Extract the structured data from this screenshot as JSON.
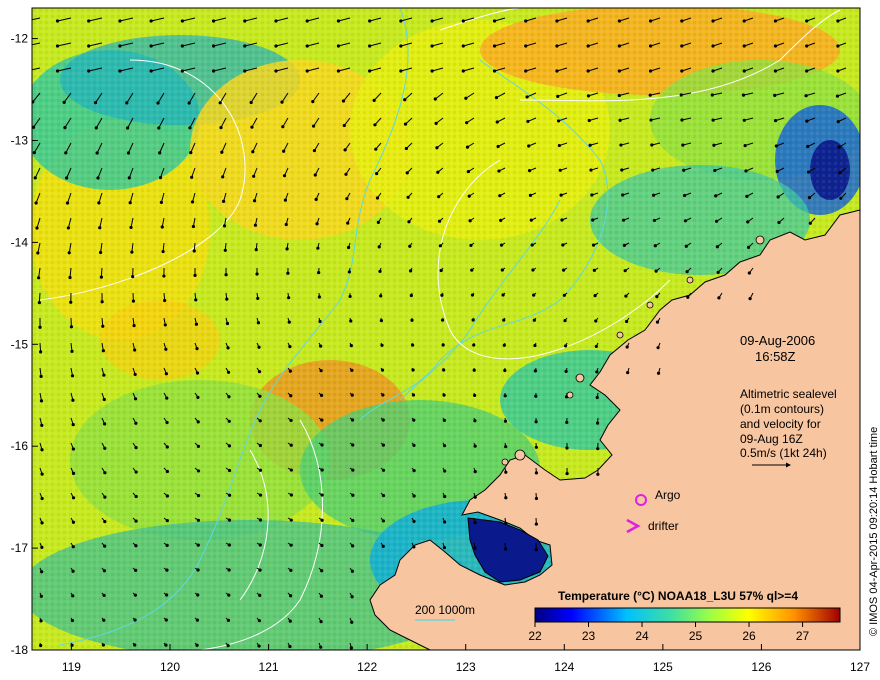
{
  "axes": {
    "lon_ticks": [
      "119",
      "120",
      "121",
      "122",
      "123",
      "124",
      "125",
      "126",
      "127"
    ],
    "lat_ticks": [
      "-12",
      "-13",
      "-14",
      "-15",
      "-16",
      "-17",
      "-18"
    ]
  },
  "map": {
    "lon_range": [
      118.6,
      127.0
    ],
    "lat_range": [
      -18.0,
      -11.7
    ],
    "land_color": "#f7c59f",
    "deep_water_color": "#0a1a8c",
    "contour_color": "#5fd8e0",
    "sealevel_contour_color": "#ffffff",
    "vector_color": "#000000"
  },
  "annotation": {
    "date": "09-Aug-2006",
    "time": "16:58Z",
    "desc_line1": "Altimetric sealevel",
    "desc_line2": "(0.1m contours)",
    "desc_line3": "and velocity for",
    "desc_line4": "09-Aug 16Z",
    "desc_line5": "0.5m/s (1kt 24h)"
  },
  "legend": {
    "argo": "Argo",
    "drifter": "drifter",
    "argo_color": "#e020e0",
    "depth_contours": "200  1000m"
  },
  "colorbar": {
    "title": "Temperature (°C) NOAA18_L3U 57% ql>=4",
    "ticks": [
      "22",
      "23",
      "24",
      "25",
      "26",
      "27"
    ],
    "range": [
      22,
      27.7
    ]
  },
  "credit": "© IMOS 04-Apr-2015 09:20:14 Hobart time"
}
